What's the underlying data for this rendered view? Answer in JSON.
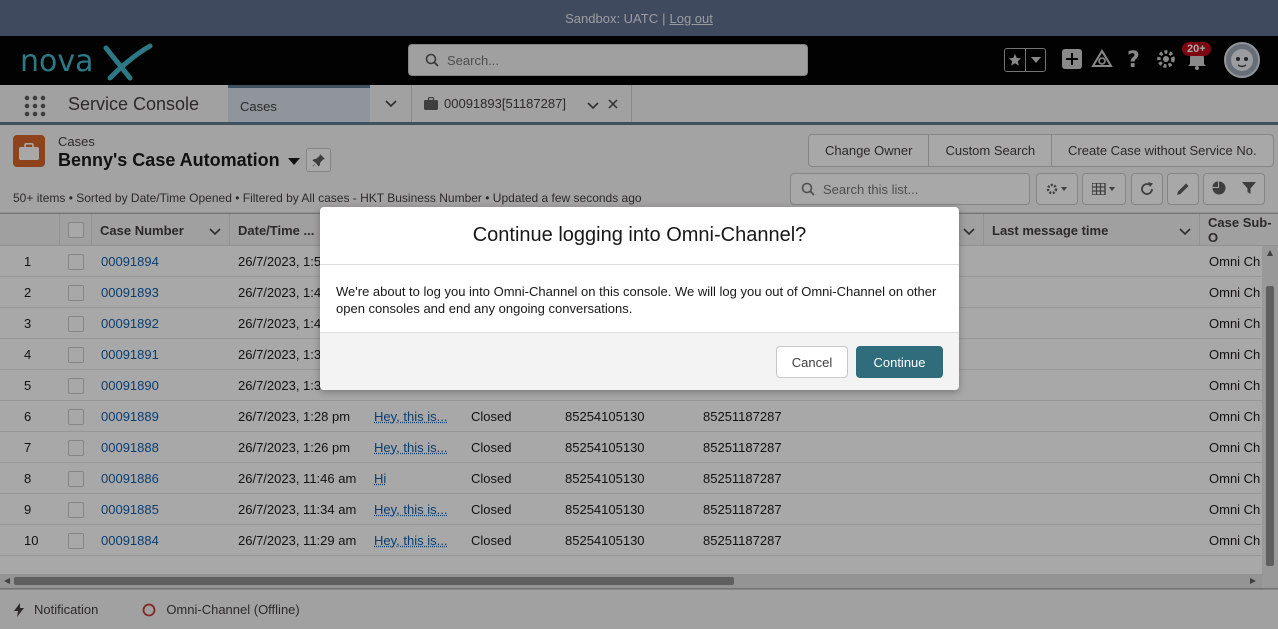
{
  "sandbox": {
    "label": "Sandbox: UATC",
    "separator": "|",
    "logout": "Log out"
  },
  "header": {
    "logo_alt": "novaX",
    "search_placeholder": "Search...",
    "notification_count": "20+"
  },
  "nav": {
    "app_title": "Service Console",
    "tabs": [
      {
        "label": "Cases"
      },
      {
        "label": "00091893[51187287]"
      }
    ]
  },
  "list": {
    "object_label": "Cases",
    "view_name": "Benny's Case Automation",
    "meta": "50+ items • Sorted by Date/Time Opened • Filtered by All cases - HKT Business Number • Updated a few seconds ago",
    "actions": [
      "Change Owner",
      "Custom Search",
      "Create Case without Service No."
    ],
    "search_placeholder": "Search this list..."
  },
  "table": {
    "columns": [
      "Case Number",
      "Date/Time ...",
      "Last message time",
      "Case Sub-O"
    ],
    "rows": [
      {
        "n": "1",
        "case": "00091894",
        "dt": "26/7/2023, 1:5",
        "subj": "",
        "status": "",
        "from": "",
        "to": "",
        "sub": "Omni Ch"
      },
      {
        "n": "2",
        "case": "00091893",
        "dt": "26/7/2023, 1:4",
        "subj": "",
        "status": "",
        "from": "",
        "to": "",
        "sub": "Omni Ch"
      },
      {
        "n": "3",
        "case": "00091892",
        "dt": "26/7/2023, 1:4",
        "subj": "",
        "status": "",
        "from": "",
        "to": "",
        "sub": "Omni Ch"
      },
      {
        "n": "4",
        "case": "00091891",
        "dt": "26/7/2023, 1:3",
        "subj": "",
        "status": "",
        "from": "",
        "to": "",
        "sub": "Omni Ch"
      },
      {
        "n": "5",
        "case": "00091890",
        "dt": "26/7/2023, 1:3",
        "subj": "",
        "status": "",
        "from": "",
        "to": "",
        "sub": "Omni Ch"
      },
      {
        "n": "6",
        "case": "00091889",
        "dt": "26/7/2023, 1:28 pm",
        "subj": "Hey, this is...",
        "status": "Closed",
        "from": "85254105130",
        "to": "85251187287",
        "sub": "Omni Ch"
      },
      {
        "n": "7",
        "case": "00091888",
        "dt": "26/7/2023, 1:26 pm",
        "subj": "Hey, this is...",
        "status": "Closed",
        "from": "85254105130",
        "to": "85251187287",
        "sub": "Omni Ch"
      },
      {
        "n": "8",
        "case": "00091886",
        "dt": "26/7/2023, 11:46 am",
        "subj": "Hi",
        "status": "Closed",
        "from": "85254105130",
        "to": "85251187287",
        "sub": "Omni Ch"
      },
      {
        "n": "9",
        "case": "00091885",
        "dt": "26/7/2023, 11:34 am",
        "subj": "Hey, this is...",
        "status": "Closed",
        "from": "85254105130",
        "to": "85251187287",
        "sub": "Omni Ch"
      },
      {
        "n": "10",
        "case": "00091884",
        "dt": "26/7/2023, 11:29 am",
        "subj": "Hey, this is...",
        "status": "Closed",
        "from": "85254105130",
        "to": "85251187287",
        "sub": "Omni Ch"
      }
    ]
  },
  "utility": {
    "notification": "Notification",
    "omni": "Omni-Channel (Offline)"
  },
  "modal": {
    "title": "Continue logging into Omni-Channel?",
    "body": "We're about to log you into Omni-Channel on this console. We will log you out of Omni-Channel on other open consoles and end any ongoing conversations.",
    "cancel": "Cancel",
    "continue": "Continue"
  },
  "colors": {
    "brand": "#2f6d7c",
    "link": "#0b5cab",
    "object_icon": "#d8642a",
    "badge": "#ba0517"
  }
}
